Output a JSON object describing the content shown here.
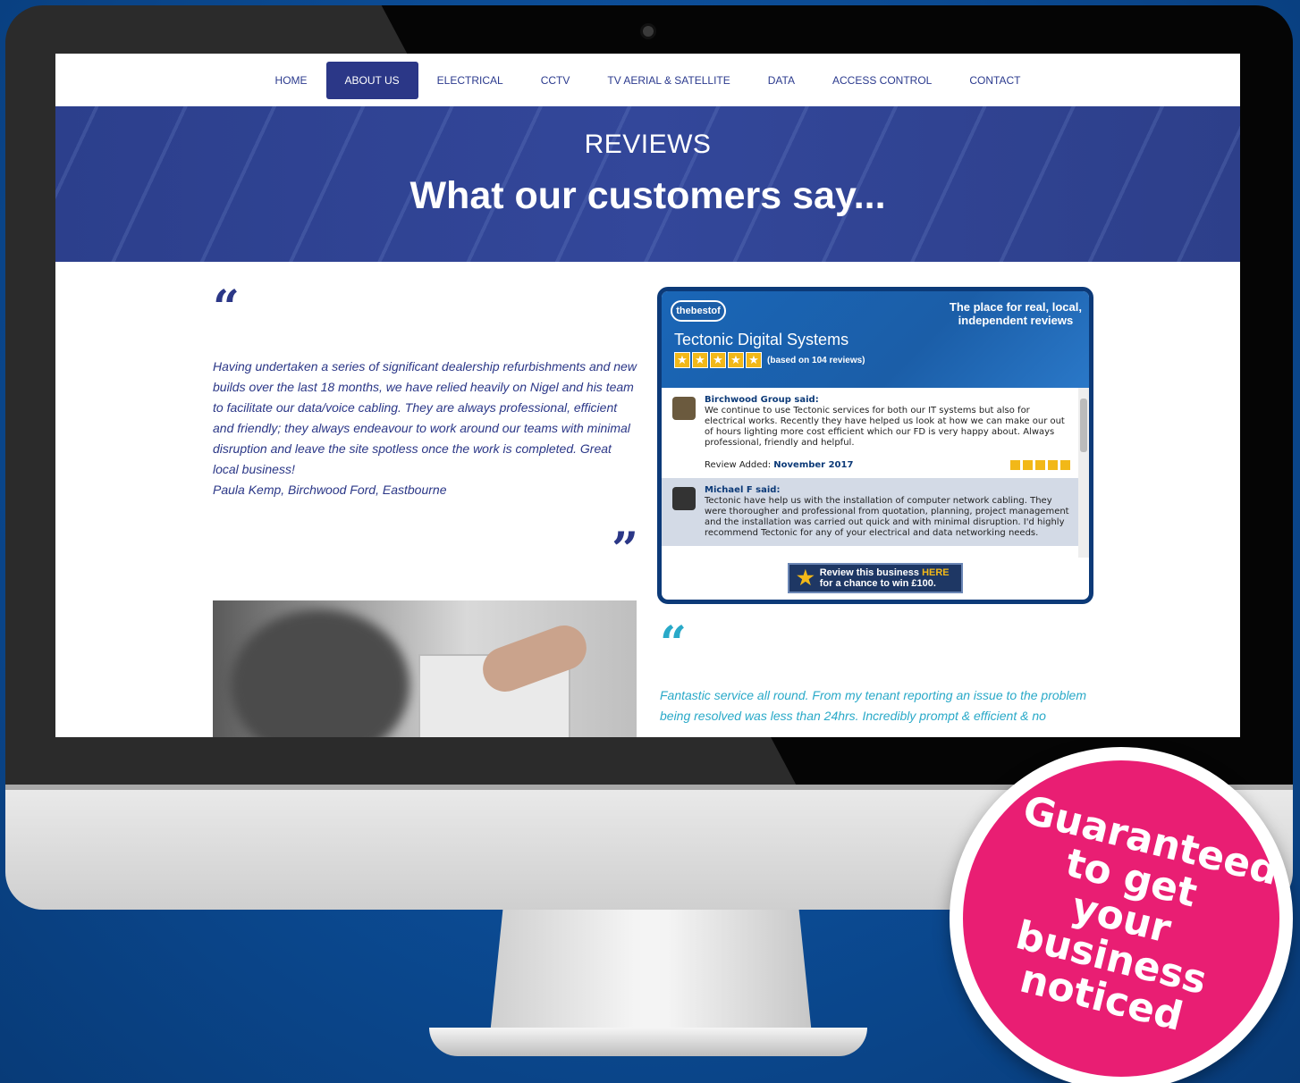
{
  "nav": {
    "items": [
      {
        "label": "HOME"
      },
      {
        "label": "ABOUT US"
      },
      {
        "label": "ELECTRICAL"
      },
      {
        "label": "CCTV"
      },
      {
        "label": "TV AERIAL & SATELLITE"
      },
      {
        "label": "DATA"
      },
      {
        "label": "ACCESS CONTROL"
      },
      {
        "label": "CONTACT"
      }
    ],
    "active": "ABOUT US"
  },
  "hero": {
    "kicker": "REVIEWS",
    "title": "What our customers say..."
  },
  "testimonial_left": {
    "open_mark": "“",
    "text": "Having undertaken a series of significant dealership refurbishments and new builds over the last 18 months, we have relied heavily on Nigel and his team to facilitate our data/voice cabling. They are always professional, efficient and friendly; they always endeavour to work around our teams with minimal disruption and leave the site spotless once the work is completed. Great local business!",
    "author": "Paula Kemp, Birchwood Ford, Eastbourne",
    "close_mark": "”"
  },
  "widget": {
    "logo": "thebestof",
    "tagline_1": "The place for real, local,",
    "tagline_2": "independent reviews",
    "business_name": "Tectonic Digital Systems",
    "rating_note": "(based on 104 reviews)",
    "reviews": [
      {
        "name": "Birchwood Group said:",
        "text": "We continue to use Tectonic services for both our IT systems but also for electrical works. Recently they have helped us look at how we can make our out of hours lighting more cost efficient which our FD is very happy about. Always professional, friendly and helpful.",
        "added_label": "Review Added:",
        "added_date": "November 2017"
      },
      {
        "name": "Michael F said:",
        "text": "Tectonic have help us with the installation of computer network cabling. They were thorougher and professional from quotation, planning, project management and the installation was carried out quick and with minimal disruption. I'd highly recommend Tectonic for any of your electrical and data networking needs."
      }
    ],
    "cta_line1": "Review this business",
    "cta_here": "HERE",
    "cta_line2": "for a chance to win £100."
  },
  "testimonial_right": {
    "open_mark": "“",
    "text": "Fantastic service all round. From my tenant reporting an issue to the problem being resolved was less than 24hrs. Incredibly prompt & efficient & no"
  },
  "badge": {
    "text": "Guaranteed to get your business noticed"
  },
  "colors": {
    "brand_navy": "#2b3787",
    "accent_teal": "#29a9c8",
    "badge_pink": "#e91e73",
    "widget_blue": "#1b5ea8"
  }
}
